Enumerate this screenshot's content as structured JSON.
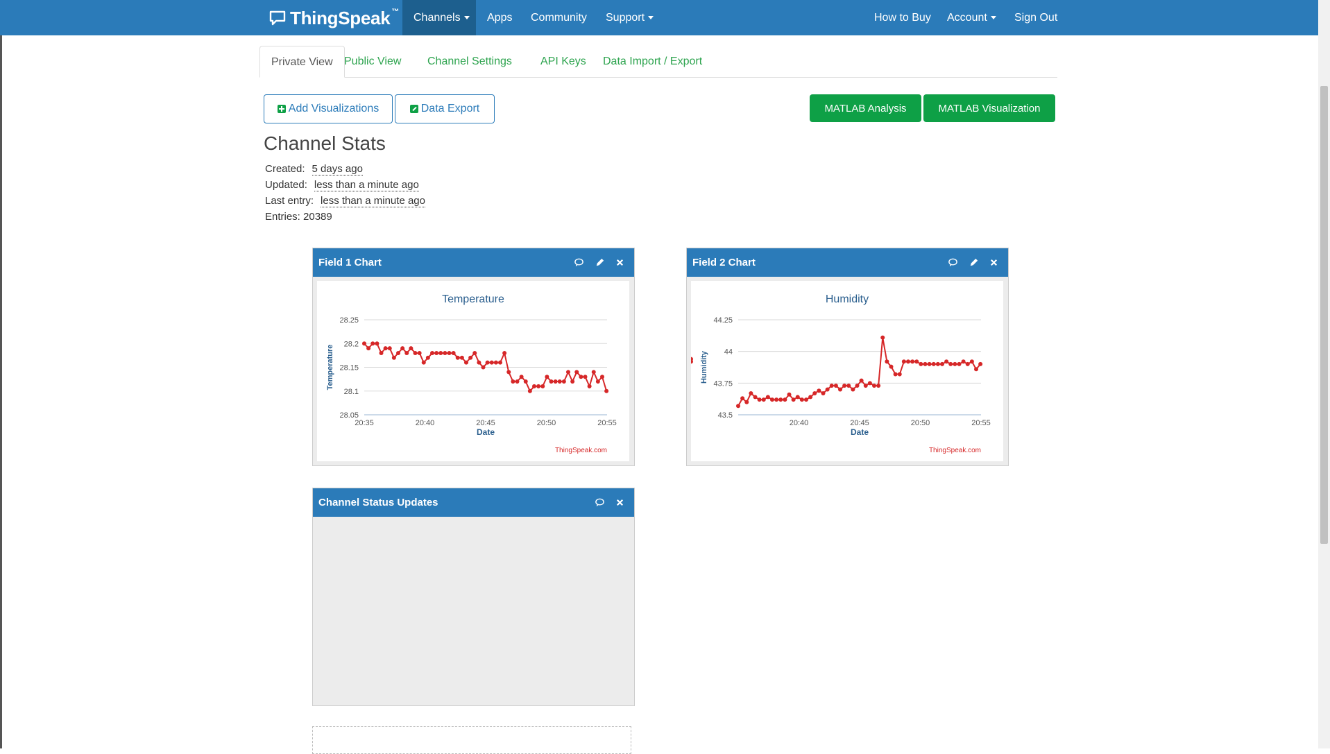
{
  "navbar": {
    "brand": "ThingSpeak",
    "brand_tm": "™",
    "items": {
      "channels": "Channels",
      "apps": "Apps",
      "community": "Community",
      "support": "Support",
      "how_to_buy": "How to Buy",
      "account": "Account",
      "sign_out": "Sign Out"
    }
  },
  "tabs": [
    "Private View",
    "Public View",
    "Channel Settings",
    "API Keys",
    "Data Import / Export"
  ],
  "toolbar": {
    "add_visualizations": "Add Visualizations",
    "data_export": "Data Export",
    "matlab_analysis": "MATLAB Analysis",
    "matlab_visualization": "MATLAB Visualization"
  },
  "stats": {
    "title": "Channel Stats",
    "created_label": "Created:",
    "created_value": "5 days ago",
    "updated_label": "Updated:",
    "updated_value": "less than a minute ago",
    "last_entry_label": "Last entry:",
    "last_entry_value": "less than a minute ago",
    "entries_label": "Entries:",
    "entries_value": "20389"
  },
  "widgets": {
    "field1": {
      "header": "Field 1 Chart"
    },
    "field2": {
      "header": "Field 2 Chart"
    },
    "status": {
      "header": "Channel Status Updates"
    }
  },
  "colors": {
    "navbar": "#2b7bb9",
    "nav_active": "#1d5f8e",
    "tab_link": "#2ea44f",
    "green_button": "#0ea046",
    "series": "#d62728",
    "axis_text": "#2b5f8e",
    "credit": "#d62728"
  },
  "chart_data": [
    {
      "type": "line",
      "title": "Temperature",
      "xlabel": "Date",
      "ylabel": "Temperature",
      "ylim": [
        28.05,
        28.25
      ],
      "yticks": [
        "28.25",
        "28.2",
        "28.15",
        "28.1",
        "28.05"
      ],
      "xticks": [
        {
          "t": 0,
          "label": "20:35"
        },
        {
          "t": 5,
          "label": "20:40"
        },
        {
          "t": 10,
          "label": "20:45"
        },
        {
          "t": 15,
          "label": "20:50"
        },
        {
          "t": 20,
          "label": "20:55"
        }
      ],
      "x_range_minutes": [
        0,
        20
      ],
      "credit": "ThingSpeak.com",
      "grid": true,
      "legend": false,
      "x": [
        0.0,
        0.35,
        0.7,
        1.05,
        1.4,
        1.75,
        2.1,
        2.45,
        2.8,
        3.15,
        3.5,
        3.85,
        4.2,
        4.55,
        4.9,
        5.25,
        5.6,
        5.95,
        6.3,
        6.65,
        7.0,
        7.35,
        7.7,
        8.05,
        8.4,
        8.75,
        9.1,
        9.45,
        9.8,
        10.15,
        10.5,
        10.85,
        11.2,
        11.55,
        11.9,
        12.25,
        12.6,
        12.95,
        13.3,
        13.65,
        14.0,
        14.35,
        14.7,
        15.05,
        15.4,
        15.75,
        16.1,
        16.45,
        16.8,
        17.15,
        17.5,
        17.85,
        18.2,
        18.55,
        18.9,
        19.25,
        19.6,
        19.95
      ],
      "values": [
        28.2,
        28.19,
        28.2,
        28.2,
        28.18,
        28.19,
        28.19,
        28.17,
        28.18,
        28.19,
        28.18,
        28.19,
        28.18,
        28.18,
        28.16,
        28.17,
        28.18,
        28.18,
        28.18,
        28.18,
        28.18,
        28.18,
        28.17,
        28.17,
        28.16,
        28.17,
        28.18,
        28.16,
        28.15,
        28.16,
        28.16,
        28.16,
        28.16,
        28.18,
        28.14,
        28.12,
        28.12,
        28.13,
        28.12,
        28.1,
        28.11,
        28.11,
        28.11,
        28.13,
        28.12,
        28.12,
        28.12,
        28.12,
        28.14,
        28.12,
        28.14,
        28.13,
        28.13,
        28.11,
        28.14,
        28.12,
        28.13,
        28.1
      ]
    },
    {
      "type": "line",
      "title": "Humidity",
      "xlabel": "Date",
      "ylabel": "Humidity",
      "ylim": [
        43.5,
        44.25
      ],
      "yticks": [
        "44.25",
        "44",
        "43.75",
        "43.5"
      ],
      "xticks": [
        {
          "t": 5,
          "label": "20:40"
        },
        {
          "t": 10,
          "label": "20:45"
        },
        {
          "t": 15,
          "label": "20:50"
        },
        {
          "t": 20,
          "label": "20:55"
        }
      ],
      "x_range_minutes": [
        0,
        20
      ],
      "credit": "ThingSpeak.com",
      "grid": true,
      "legend": false,
      "x": [
        0.0,
        0.35,
        0.7,
        1.05,
        1.4,
        1.75,
        2.1,
        2.45,
        2.8,
        3.15,
        3.5,
        3.85,
        4.2,
        4.55,
        4.9,
        5.25,
        5.6,
        5.95,
        6.3,
        6.65,
        7.0,
        7.35,
        7.7,
        8.05,
        8.4,
        8.75,
        9.1,
        9.45,
        9.8,
        10.15,
        10.5,
        10.85,
        11.2,
        11.55,
        11.9,
        12.25,
        12.6,
        12.95,
        13.3,
        13.65,
        14.0,
        14.35,
        14.7,
        15.05,
        15.4,
        15.75,
        16.1,
        16.45,
        16.8,
        17.15,
        17.5,
        17.85,
        18.2,
        18.55,
        18.9,
        19.25,
        19.6,
        19.95
      ],
      "values": [
        43.57,
        43.63,
        43.6,
        43.67,
        43.64,
        43.62,
        43.62,
        43.64,
        43.62,
        43.62,
        43.62,
        43.62,
        43.66,
        43.62,
        43.64,
        43.62,
        43.62,
        43.64,
        43.67,
        43.69,
        43.67,
        43.7,
        43.73,
        43.73,
        43.7,
        43.73,
        43.73,
        43.7,
        43.73,
        43.77,
        43.73,
        43.75,
        43.73,
        43.73,
        44.11,
        43.92,
        43.88,
        43.82,
        43.82,
        43.92,
        43.92,
        43.92,
        43.92,
        43.9,
        43.9,
        43.9,
        43.9,
        43.9,
        43.9,
        43.92,
        43.9,
        43.9,
        43.9,
        43.92,
        43.9,
        43.92,
        43.86,
        43.9,
        43.94,
        43.92
      ]
    }
  ]
}
